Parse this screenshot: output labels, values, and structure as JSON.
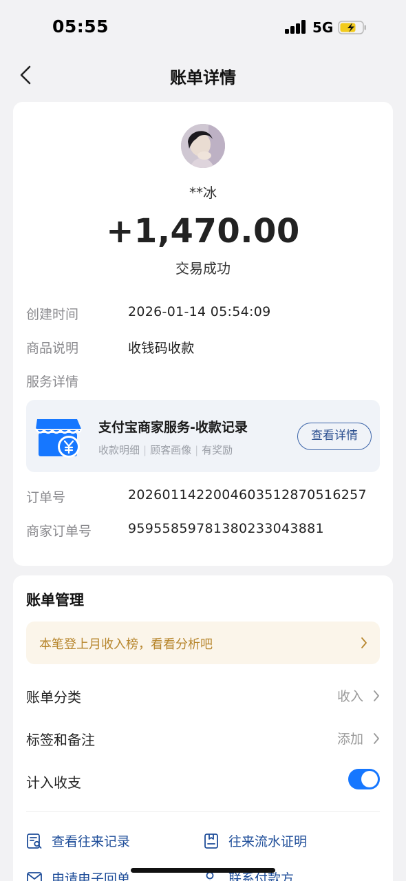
{
  "status_bar": {
    "time": "05:55",
    "network": "5G"
  },
  "nav": {
    "title": "账单详情"
  },
  "transaction": {
    "payer_name": "**冰",
    "amount": "+1,470.00",
    "status": "交易成功"
  },
  "details": {
    "created_label": "创建时间",
    "created_value": "2026-01-14 05:54:09",
    "description_label": "商品说明",
    "description_value": "收钱码收款",
    "service_label": "服务详情",
    "order_label": "订单号",
    "order_value": "2026011422004603512870516257",
    "merchant_order_label": "商家订单号",
    "merchant_order_value": "9595585978138023304388​1"
  },
  "service_card": {
    "title": "支付宝商家服务-收款记录",
    "tags": [
      "收款明细",
      "顾客画像",
      "有奖励"
    ],
    "button": "查看详情",
    "icon": "store-yuan-icon"
  },
  "manage": {
    "title": "账单管理",
    "promo": "本笔登上月收入榜，看看分析吧",
    "category_label": "账单分类",
    "category_value": "收入",
    "tags_label": "标签和备注",
    "tags_value": "添加",
    "count_label": "计入收支",
    "count_enabled": true,
    "links": [
      {
        "label": "查看往来记录",
        "icon": "records-search-icon"
      },
      {
        "label": "往来流水证明",
        "icon": "document-proof-icon"
      },
      {
        "label": "申请电子回单",
        "icon": "mail-icon"
      },
      {
        "label": "联系付款方",
        "icon": "contact-icon"
      }
    ]
  },
  "colors": {
    "accent": "#1677ff",
    "link": "#1e4d99",
    "promo_text": "#b7862d",
    "promo_bg": "#fbf5ea",
    "background": "#f2f2f4"
  }
}
